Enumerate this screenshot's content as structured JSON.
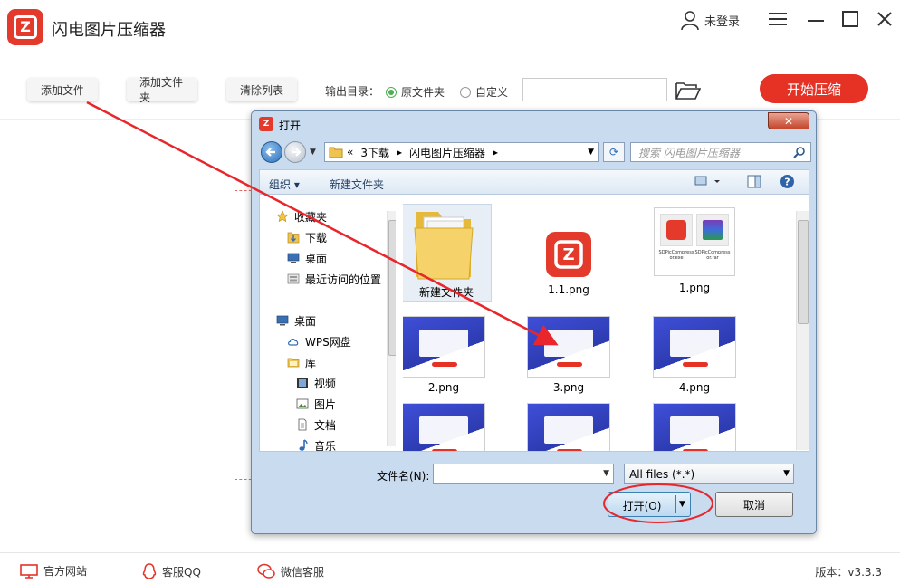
{
  "app": {
    "title": "闪电图片压缩器",
    "logo_letter": "Z",
    "user_label": "未登录"
  },
  "toolbar": {
    "add_file": "添加文件",
    "add_folder": "添加文件夹",
    "clear_list": "清除列表",
    "output_label": "输出目录：",
    "radio_original": "原文件夹",
    "radio_custom": "自定义",
    "path_value": "",
    "start": "开始压缩"
  },
  "footer": {
    "website": "官方网站",
    "qq": "客服QQ",
    "wechat": "微信客服",
    "version": "版本：v3.3.3"
  },
  "dialog": {
    "title": "打开",
    "address": {
      "prefix": "«",
      "segments": [
        "3下载",
        "闪电图片压缩器"
      ]
    },
    "search_placeholder": "搜索 闪电图片压缩器",
    "cmd": {
      "organize": "组织 ▾",
      "new_folder": "新建文件夹"
    },
    "nav": {
      "favorites": "收藏夹",
      "downloads": "下载",
      "desktop": "桌面",
      "recent": "最近访问的位置",
      "desktop2": "桌面",
      "wps": "WPS网盘",
      "library": "库",
      "video": "视频",
      "pictures": "图片",
      "documents": "文档",
      "music": "音乐"
    },
    "files": [
      {
        "name": "新建文件夹"
      },
      {
        "name": "1.1.png"
      },
      {
        "name": "1.png"
      },
      {
        "name": "2.png"
      },
      {
        "name": "3.png"
      },
      {
        "name": "4.png"
      }
    ],
    "thumb_text": {
      "file_a": "SDPicCompressor.exe",
      "file_b": "SDPicCompressor.rar"
    },
    "filename_label": "文件名(N):",
    "filename_value": "",
    "filetype": "All files (*.*)",
    "open": "打开(O)",
    "cancel": "取消"
  },
  "colors": {
    "brand_red": "#e53225",
    "radio_green": "#4caf50",
    "annotation_red": "#e8262b"
  }
}
